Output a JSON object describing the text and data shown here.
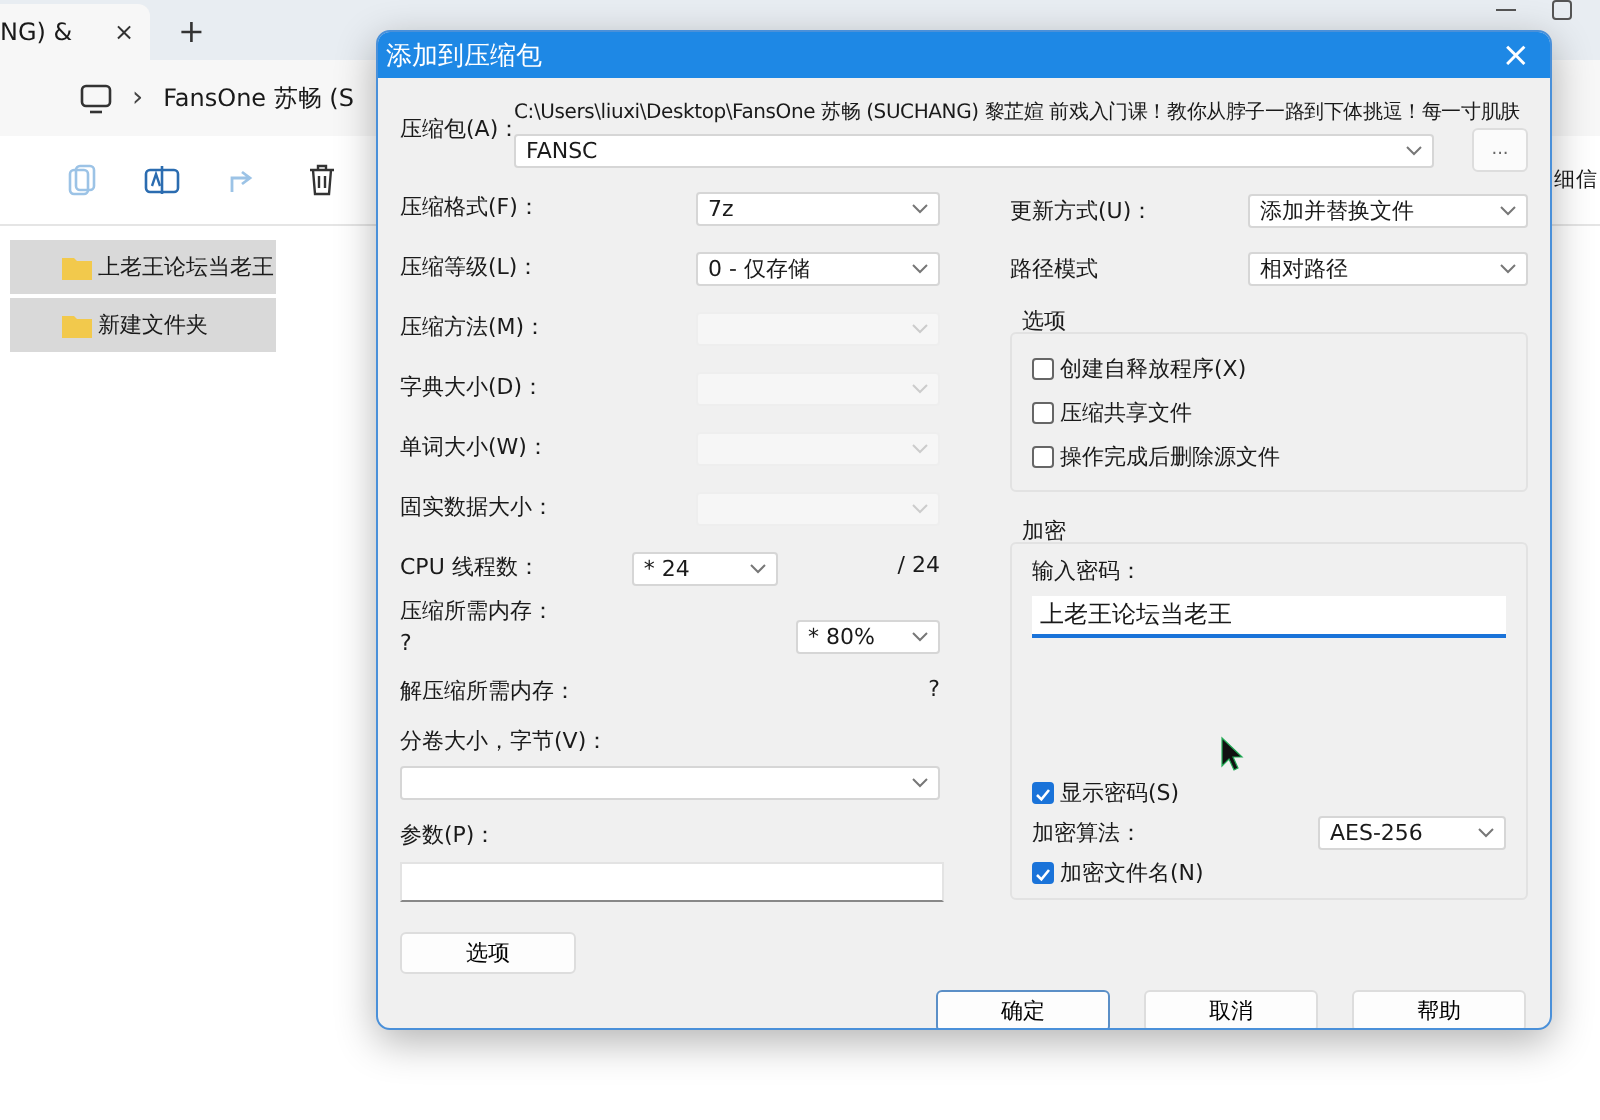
{
  "explorer": {
    "tab": {
      "title": "NG) &",
      "close": "×"
    },
    "new_tab": "+",
    "breadcrumb": {
      "separator": "›",
      "path": "FansOne 苏畅 (S"
    },
    "view_label": "细信",
    "files": [
      {
        "name": "上老王论坛当老王",
        "selected": true
      },
      {
        "name": "新建文件夹",
        "selected": true
      }
    ]
  },
  "dialog": {
    "title": "添加到压缩包",
    "close": "×",
    "archive": {
      "label": "压缩包(A)：",
      "path": "C:\\Users\\liuxi\\Desktop\\FansOne 苏畅 (SUCHANG) 黎芷媗 前戏入门课！教你从脖子一路到下体挑逗！每一寸肌肤",
      "value": "FANSC",
      "browse": "..."
    },
    "left_fields": [
      {
        "label": "压缩格式(F)：",
        "value": "7z",
        "disabled": false
      },
      {
        "label": "压缩等级(L)：",
        "value": "0 - 仅存储",
        "disabled": false
      },
      {
        "label": "压缩方法(M)：",
        "disabled": true
      },
      {
        "label": "字典大小(D)：",
        "disabled": true
      },
      {
        "label": "单词大小(W)：",
        "disabled": true
      },
      {
        "label": "固实数据大小：",
        "disabled": true
      }
    ],
    "threads": {
      "label": "CPU 线程数：",
      "value": "* 24",
      "max": "/ 24"
    },
    "memory": {
      "label": "压缩所需内存：",
      "value": "?",
      "percent": "* 80%"
    },
    "decompress_memory": {
      "label": "解压缩所需内存：",
      "value": "?"
    },
    "volume": {
      "label": "分卷大小，字节(V)："
    },
    "parameters": {
      "label": "参数(P)："
    },
    "options_button": "选项",
    "update_mode": {
      "label": "更新方式(U)：",
      "value": "添加并替换文件"
    },
    "path_mode": {
      "label": "路径模式",
      "value": "相对路径"
    },
    "options": {
      "title": "选项",
      "checkboxes": [
        {
          "label": "创建自释放程序(X)",
          "checked": false
        },
        {
          "label": "压缩共享文件",
          "checked": false
        },
        {
          "label": "操作完成后删除源文件",
          "checked": false
        }
      ]
    },
    "encryption": {
      "title": "加密",
      "password_label": "输入密码：",
      "password": "上老王论坛当老王",
      "show_password": {
        "label": "显示密码(S)",
        "checked": true
      },
      "method_label": "加密算法：",
      "method": "AES-256",
      "encrypt_names": {
        "label": "加密文件名(N)",
        "checked": true
      }
    },
    "buttons": [
      {
        "label": "确定",
        "default": true
      },
      {
        "label": "取消",
        "default": false
      },
      {
        "label": "帮助",
        "default": false
      }
    ]
  }
}
